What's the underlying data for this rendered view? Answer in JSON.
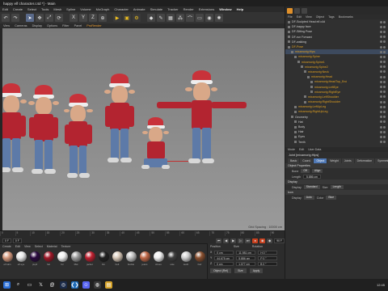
{
  "window": {
    "title": "happy elf character.c4d *] - Main"
  },
  "menubar": {
    "items": [
      "Edit",
      "Create",
      "Select",
      "Tools",
      "Mesh",
      "Spline",
      "Volume",
      "MoGraph",
      "Character",
      "Animate",
      "Simulate",
      "Tracker",
      "Render",
      "Extensions",
      "Window",
      "Help"
    ]
  },
  "toolbar": {
    "icons": [
      "undo-icon",
      "redo-icon",
      "live-select-icon",
      "move-icon",
      "scale-icon",
      "rotate-icon",
      "x-axis-icon",
      "y-axis-icon",
      "z-axis-icon",
      "world-coord-icon",
      "render-view-icon",
      "render-picture-icon",
      "edit-render-icon",
      "cube-icon",
      "pen-icon",
      "subdivide-icon",
      "array-icon",
      "bend-icon",
      "floor-icon",
      "camera-icon",
      "light-icon"
    ]
  },
  "viewport_menu": {
    "items": [
      "View",
      "Cameras",
      "Display",
      "Options",
      "Filter",
      "Panel",
      "ProRender"
    ]
  },
  "viewport": {
    "status": "Grid Spacing : 10000 cm"
  },
  "object_manager": {
    "menu": [
      "File",
      "Edit",
      "View",
      "Object",
      "Tags",
      "Bookmarks"
    ],
    "rows": [
      {
        "label": "DF-Sculpted Head elf.c4d",
        "indent": 0,
        "color": "w"
      },
      {
        "label": "DF-happy face",
        "indent": 0,
        "color": "w"
      },
      {
        "label": "DF-Sitting Pose",
        "indent": 0,
        "color": "w"
      },
      {
        "label": "DF-run Forward",
        "indent": 0,
        "color": "w"
      },
      {
        "label": "DF-walking",
        "indent": 0,
        "color": "w"
      },
      {
        "label": "DF-Pose",
        "indent": 0,
        "color": "o"
      },
      {
        "label": "mixamorig:Hips",
        "indent": 1,
        "color": "o"
      },
      {
        "label": "mixamorig:Spine",
        "indent": 2,
        "color": "o"
      },
      {
        "label": "mixamorig:Spine1",
        "indent": 3,
        "color": "o"
      },
      {
        "label": "mixamorig:Spine2",
        "indent": 4,
        "color": "o"
      },
      {
        "label": "mixamorig:Neck",
        "indent": 5,
        "color": "o"
      },
      {
        "label": "mixamorig:Head",
        "indent": 6,
        "color": "o"
      },
      {
        "label": "mixamorig:HeadTop_End",
        "indent": 7,
        "color": "o"
      },
      {
        "label": "mixamorig:LeftEye",
        "indent": 7,
        "color": "o"
      },
      {
        "label": "mixamorig:RightEye",
        "indent": 7,
        "color": "o"
      },
      {
        "label": "mixamorig:LeftShoulder",
        "indent": 5,
        "color": "o"
      },
      {
        "label": "mixamorig:RightShoulder",
        "indent": 5,
        "color": "o"
      },
      {
        "label": "mixamorig:LeftUpLeg",
        "indent": 2,
        "color": "o"
      },
      {
        "label": "mixamorig:RightUpLeg",
        "indent": 2,
        "color": "o"
      },
      {
        "label": "Geometry",
        "indent": 1,
        "color": "w"
      },
      {
        "label": "Hat",
        "indent": 2,
        "color": "w"
      },
      {
        "label": "Body",
        "indent": 2,
        "color": "w"
      },
      {
        "label": "Hair",
        "indent": 2,
        "color": "w"
      },
      {
        "label": "Eyes",
        "indent": 2,
        "color": "w"
      },
      {
        "label": "Teeth",
        "indent": 2,
        "color": "w"
      }
    ]
  },
  "attribute_manager": {
    "menu": [
      "Mode",
      "Edit",
      "User Data"
    ],
    "title": "Joint [mixamorig:Hips]",
    "tabs": [
      "Basic",
      "Coord.",
      "Object",
      "Weight",
      "Joints",
      "Deformation",
      "Symmetry"
    ],
    "active_tab": "Object",
    "section_object": "Object Properties",
    "bone_label": "Bone",
    "bone_value": "Off",
    "align_button": "Align",
    "length_label": "Length",
    "length_value": "5.886 cm",
    "section_display": "Display",
    "display_label": "Display",
    "display_value": "Standard",
    "size_label": "Size",
    "size_value": "Length",
    "section_icon": "Icon",
    "icon_display_label": "Display",
    "icon_display_value": "Auto",
    "icon_color_label": "Color",
    "icon_color_value": "Blue"
  },
  "timeline": {
    "ticks": [
      "0",
      "5",
      "10",
      "15",
      "20",
      "25",
      "30",
      "35",
      "40",
      "45",
      "50",
      "55",
      "60",
      "65",
      "70",
      "75",
      "80",
      "85",
      "90"
    ],
    "start": "0 F",
    "current": "0 F",
    "end": "90 F"
  },
  "materials": {
    "menu": [
      "Create",
      "Edit",
      "View",
      "Select",
      "Material",
      "Texture"
    ],
    "items": [
      {
        "name": "elf skin",
        "color": "#d79a7e"
      },
      {
        "name": "elf eye",
        "color": "#e8e8e8"
      },
      {
        "name": "pupil",
        "color": "#2a0a40"
      },
      {
        "name": "hat",
        "color": "#a01828"
      },
      {
        "name": "fur",
        "color": "#f0f0f0"
      },
      {
        "name": "Mat",
        "color": "#9a9a9a"
      },
      {
        "name": "jacket",
        "color": "#c02030"
      },
      {
        "name": "btn",
        "color": "#222222"
      },
      {
        "name": "belt",
        "color": "#d8c8b8"
      },
      {
        "name": "buckle",
        "color": "#c0c0c0"
      },
      {
        "name": "jeans",
        "color": "#c06848"
      },
      {
        "name": "shoes",
        "color": "#f0f0f0"
      },
      {
        "name": "sole",
        "color": "#404040"
      },
      {
        "name": "teeth",
        "color": "#d0d0d0"
      },
      {
        "name": "hair",
        "color": "#8a5030"
      },
      {
        "name": "brow",
        "color": "#503020"
      },
      {
        "name": "Mat.1",
        "color": "#303030"
      },
      {
        "name": "Mat.2",
        "color": "#c04050"
      }
    ]
  },
  "coordinates": {
    "headers": [
      "Position",
      "Size",
      "Rotation"
    ],
    "rows": [
      {
        "axis": "X",
        "pos": "0 cm",
        "size": "11.981 cm",
        "rot": "H 0 °"
      },
      {
        "axis": "Y",
        "pos": "44.675 cm",
        "size": "5.886 cm",
        "rot": "P 0 °"
      },
      {
        "axis": "Z",
        "pos": "0 cm",
        "size": "1.077 cm",
        "rot": "B 0 °"
      }
    ],
    "mode": "Object (Rel)",
    "size_mode": "Size",
    "apply": "Apply"
  },
  "taskbar": {
    "time": "12:45",
    "icons": [
      "start-icon",
      "search-icon",
      "taskview-icon",
      "x-icon",
      "threads-icon",
      "cinema4d-icon",
      "vscode-icon",
      "discord-icon",
      "chrome-icon",
      "explorer-icon"
    ]
  }
}
